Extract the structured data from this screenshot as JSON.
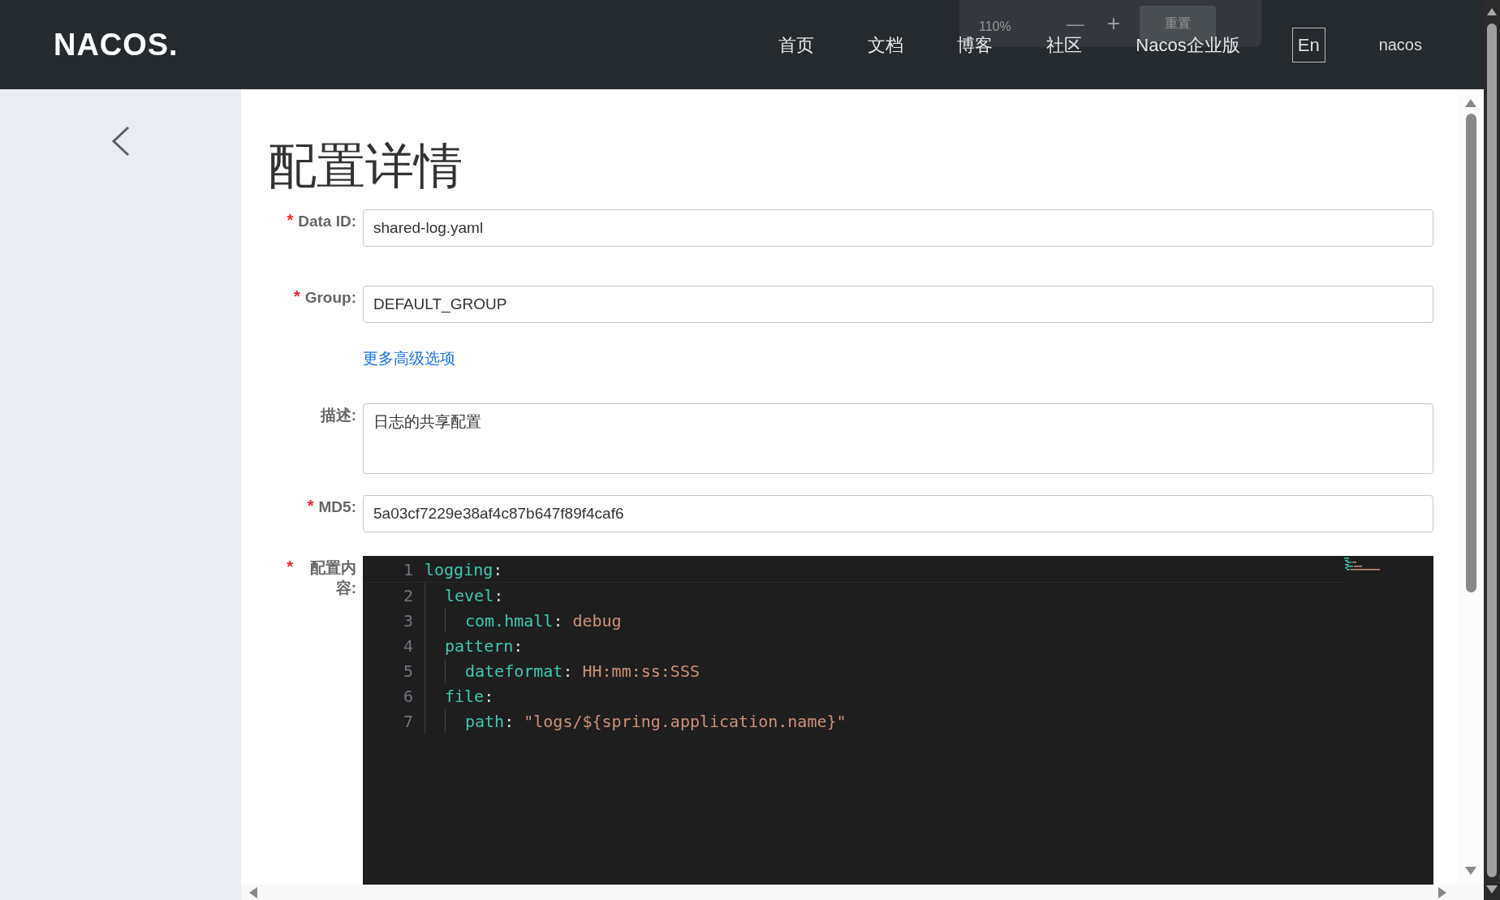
{
  "header": {
    "logo": "NACOS.",
    "nav": [
      {
        "label": "首页"
      },
      {
        "label": "文档"
      },
      {
        "label": "博客"
      },
      {
        "label": "社区"
      },
      {
        "label": "Nacos企业版"
      }
    ],
    "language_button": "En",
    "user": "nacos"
  },
  "zoom_popup": {
    "level": "110%",
    "zoom_out": "—",
    "zoom_in": "+",
    "reset": "重置"
  },
  "page_title": "配置详情",
  "form": [
    {
      "kind": "input",
      "label": "Data ID:",
      "required": true,
      "value": "shared-log.yaml"
    },
    {
      "kind": "input",
      "label": "Group:",
      "required": true,
      "value": "DEFAULT_GROUP"
    },
    {
      "kind": "link",
      "text": "更多高级选项"
    },
    {
      "kind": "textarea",
      "label": "描述:",
      "required": false,
      "value": "日志的共享配置"
    },
    {
      "kind": "input",
      "label": "MD5:",
      "required": true,
      "value": "5a03cf7229e38af4c87b647f89f4caf6"
    },
    {
      "kind": "editor",
      "label": "配置内容:",
      "required": true
    }
  ],
  "editor_lines": [
    {
      "number": "1",
      "key": "logging",
      "punct": ":",
      "children": [
        {
          "number": "2",
          "key": "level",
          "punct": ":",
          "children": [
            {
              "number": "3",
              "key": "com.hmall",
              "punct": ":",
              "value": "debug"
            }
          ]
        },
        {
          "number": "4",
          "key": "pattern",
          "punct": ":",
          "children": [
            {
              "number": "5",
              "key": "dateformat",
              "punct": ":",
              "value": "HH:mm:ss:SSS"
            }
          ]
        },
        {
          "number": "6",
          "key": "file",
          "punct": ":",
          "children": [
            {
              "number": "7",
              "key": "path",
              "punct": ":",
              "value": "\"logs/${spring.application.name}\""
            }
          ]
        }
      ]
    }
  ],
  "star": "*"
}
